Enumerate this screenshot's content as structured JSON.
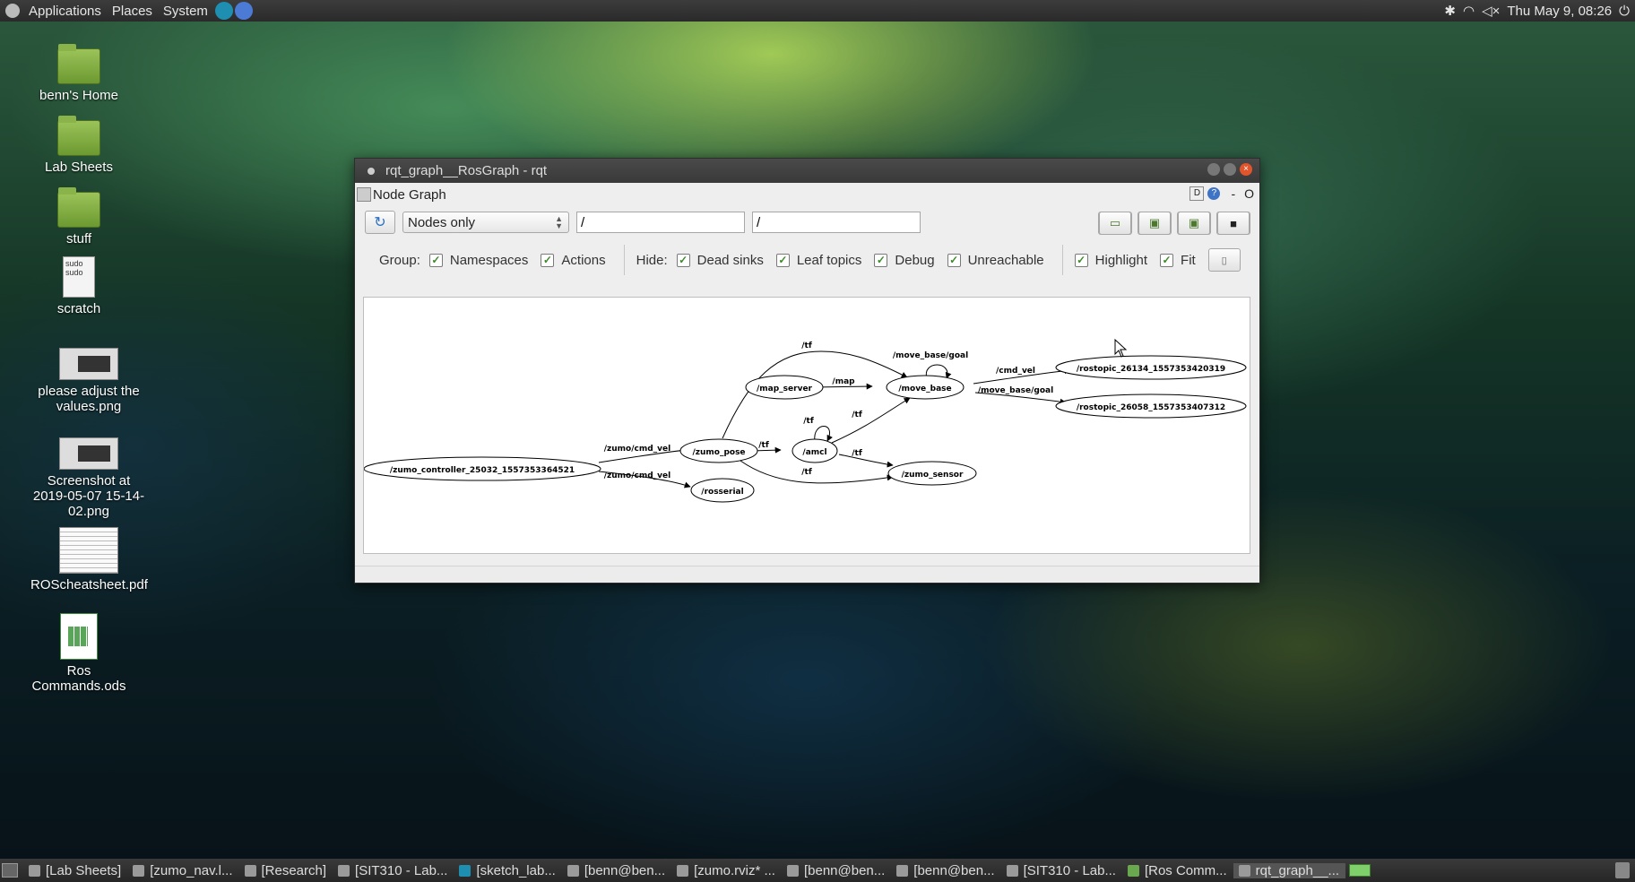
{
  "top_panel": {
    "menus": [
      "Applications",
      "Places",
      "System"
    ],
    "clock": "Thu May 9, 08:26"
  },
  "desktop_icons": [
    {
      "label": "benn's Home"
    },
    {
      "label": "Lab Sheets"
    },
    {
      "label": "stuff"
    },
    {
      "label": "scratch",
      "thumb_lines": [
        "sudo",
        "sudo"
      ]
    },
    {
      "label": "please adjust the values.png"
    },
    {
      "label": "Screenshot at 2019-05-07 15-14-02.png"
    },
    {
      "label": "ROScheatsheet.pdf"
    },
    {
      "label": "Ros Commands.ods"
    }
  ],
  "window": {
    "title": "rqt_graph__RosGraph - rqt",
    "dock_title": "Node Graph",
    "dock_d": "D",
    "dock_q": "?",
    "dock_minus": "-",
    "dock_o": "O",
    "combo_value": "Nodes only",
    "filter1_value": "/",
    "filter2_value": "/",
    "group_label": "Group:",
    "hide_label": "Hide:",
    "checkboxes": {
      "namespaces": "Namespaces",
      "actions": "Actions",
      "dead_sinks": "Dead sinks",
      "leaf_topics": "Leaf topics",
      "debug": "Debug",
      "unreachable": "Unreachable",
      "highlight": "Highlight",
      "fit": "Fit"
    },
    "checked_mark": "✓"
  },
  "graph": {
    "nodes": {
      "controller": "/zumo_controller_25032_1557353364521",
      "zumo_pose": "/zumo_pose",
      "rosserial": "/rosserial",
      "amcl": "/amcl",
      "map_server": "/map_server",
      "move_base": "/move_base",
      "zumo_sensor": "/zumo_sensor",
      "rostopic1": "/rostopic_26134_1557353420319",
      "rostopic2": "/rostopic_26058_1557353407312"
    },
    "edges": {
      "cmd_vel_pose": "/zumo/cmd_vel",
      "cmd_vel_serial": "/zumo/cmd_vel",
      "tf_pose_amcl": "/tf",
      "tf_pose_move": "/tf",
      "tf_pose_sensor": "/tf",
      "tf_amcl_self": "/tf",
      "tf_amcl_move": "/tf",
      "tf_amcl_sensor": "/tf",
      "map": "/map",
      "goal_self": "/move_base/goal",
      "cmd_vel": "/cmd_vel",
      "goal_out": "/move_base/goal"
    }
  },
  "taskbar": [
    {
      "label": "[Lab Sheets]"
    },
    {
      "label": "[zumo_nav.l..."
    },
    {
      "label": "[Research]"
    },
    {
      "label": "[SIT310 - Lab..."
    },
    {
      "label": "[sketch_lab..."
    },
    {
      "label": "[benn@ben..."
    },
    {
      "label": "[zumo.rviz* ..."
    },
    {
      "label": "[benn@ben..."
    },
    {
      "label": "[benn@ben..."
    },
    {
      "label": "[SIT310 - Lab..."
    },
    {
      "label": "[Ros Comm..."
    },
    {
      "label": "rqt_graph__..."
    }
  ]
}
